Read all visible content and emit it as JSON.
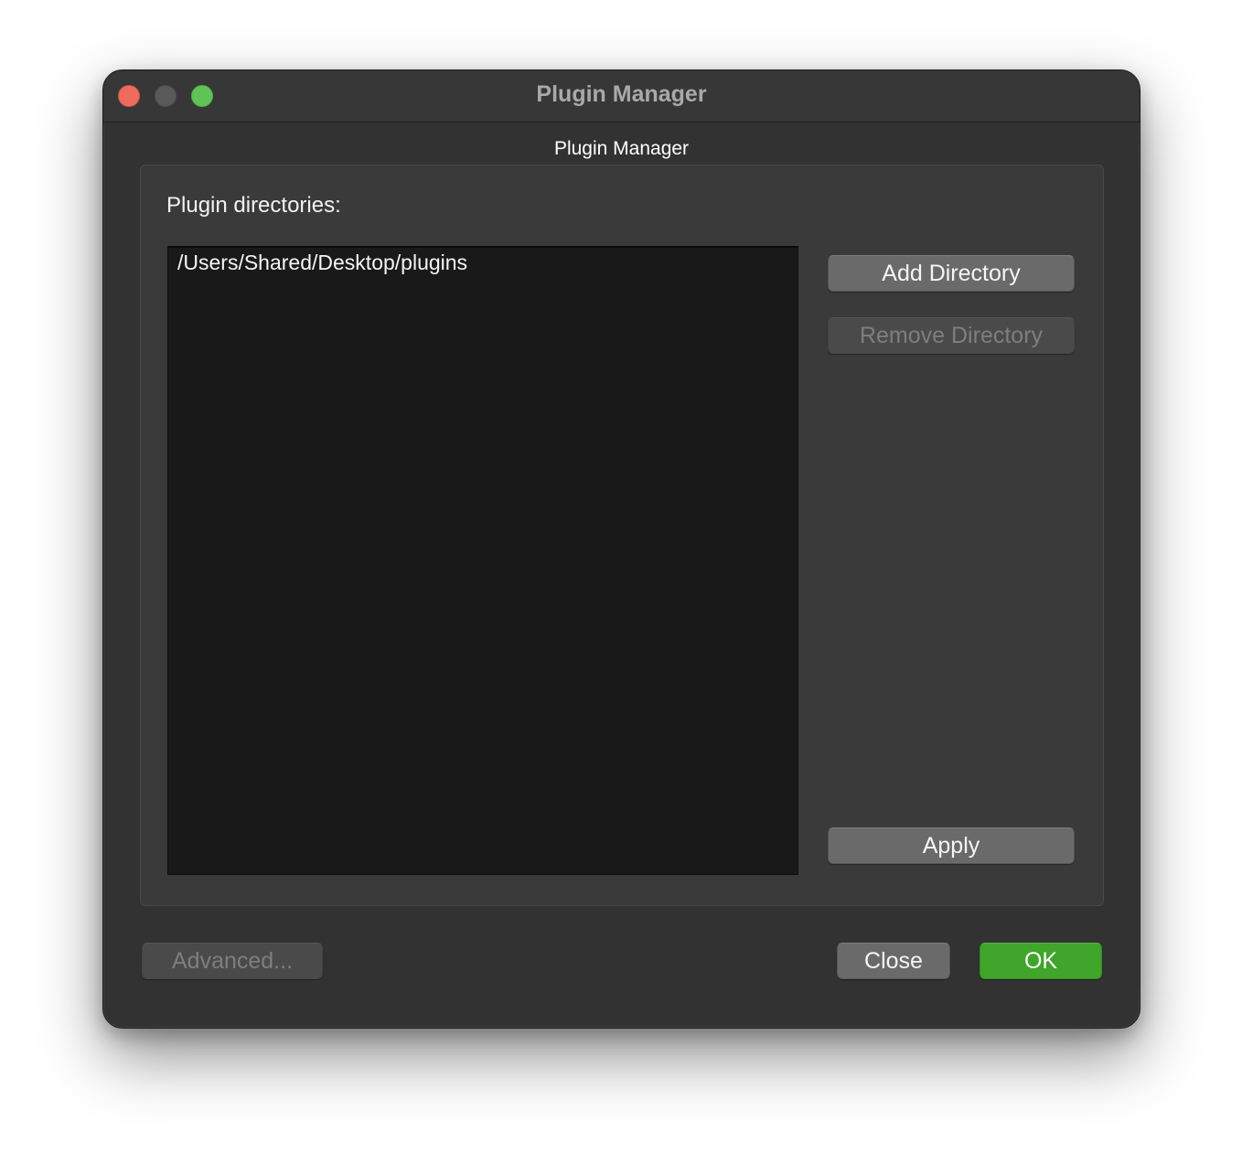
{
  "window": {
    "title": "Plugin Manager"
  },
  "group": {
    "title": "Plugin Manager",
    "directories_label": "Plugin directories:",
    "directories": [
      "/Users/Shared/Desktop/plugins"
    ]
  },
  "buttons": {
    "add_directory": "Add Directory",
    "remove_directory": "Remove Directory",
    "apply": "Apply",
    "advanced": "Advanced...",
    "close": "Close",
    "ok": "OK"
  },
  "colors": {
    "ok_button": "#3fa52b",
    "close_traffic": "#ed6a5e",
    "zoom_traffic": "#5fc454"
  }
}
